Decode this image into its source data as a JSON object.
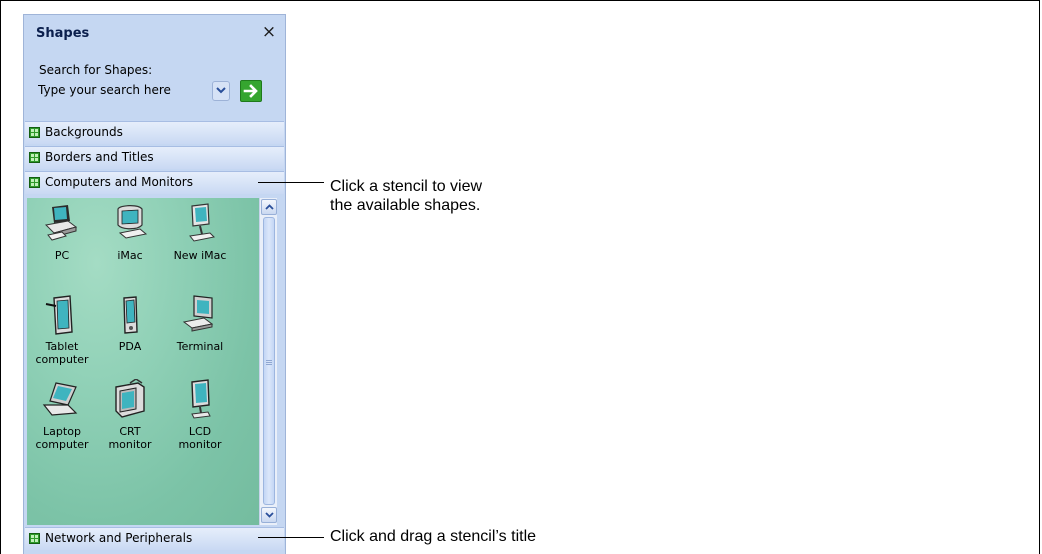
{
  "pane": {
    "title": "Shapes",
    "close_glyph": "×",
    "search_label": "Search for Shapes:",
    "search_placeholder": "Type your search here"
  },
  "stencils": [
    {
      "label": "Backgrounds",
      "icon": "stencil-icon"
    },
    {
      "label": "Borders and Titles",
      "icon": "stencil-icon"
    },
    {
      "label": "Computers and Monitors",
      "icon": "stencil-icon"
    },
    {
      "label": "Network and Peripherals",
      "icon": "stencil-icon"
    }
  ],
  "shapes": [
    {
      "label": "PC",
      "icon": "pc-icon"
    },
    {
      "label": "iMac",
      "icon": "imac-icon"
    },
    {
      "label": "New iMac",
      "icon": "new-imac-icon"
    },
    {
      "label": "Tablet\ncomputer",
      "icon": "tablet-icon"
    },
    {
      "label": "PDA",
      "icon": "pda-icon"
    },
    {
      "label": "Terminal",
      "icon": "terminal-icon"
    },
    {
      "label": "Laptop\ncomputer",
      "icon": "laptop-icon"
    },
    {
      "label": "CRT\nmonitor",
      "icon": "crt-monitor-icon"
    },
    {
      "label": "LCD\nmonitor",
      "icon": "lcd-monitor-icon"
    }
  ],
  "callouts": [
    {
      "line1": "Click a stencil to view",
      "line2": "the available shapes."
    },
    {
      "line1": "Click and drag a stencil’s title"
    }
  ]
}
